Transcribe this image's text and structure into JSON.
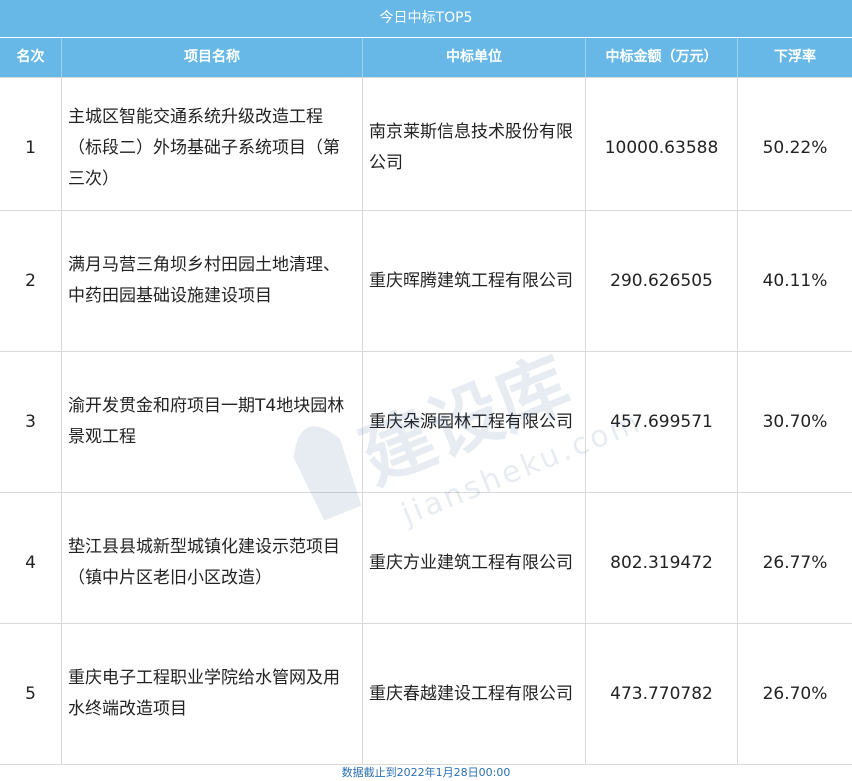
{
  "title": "今日中标TOP5",
  "headers": [
    "名次",
    "项目名称",
    "中标单位",
    "中标金额（万元）",
    "下浮率"
  ],
  "rows": [
    {
      "rank": "1",
      "project": "主城区智能交通系统升级改造工程（标段二）外场基础子系统项目（第三次）",
      "company": "南京莱斯信息技术股份有限公司",
      "amount": "10000.63588",
      "rate": "50.22%"
    },
    {
      "rank": "2",
      "project": "满月马营三角坝乡村田园土地清理、中药田园基础设施建设项目",
      "company": "重庆晖腾建筑工程有限公司",
      "amount": "290.626505",
      "rate": "40.11%"
    },
    {
      "rank": "3",
      "project": "渝开发贯金和府项目一期T4地块园林景观工程",
      "company": "重庆朵源园林工程有限公司",
      "amount": "457.699571",
      "rate": "30.70%"
    },
    {
      "rank": "4",
      "project": "垫江县县城新型城镇化建设示范项目（镇中片区老旧小区改造）",
      "company": "重庆方业建筑工程有限公司",
      "amount": "802.319472",
      "rate": "26.77%"
    },
    {
      "rank": "5",
      "project": "重庆电子工程职业学院给水管网及用水终端改造项目",
      "company": "重庆春越建设工程有限公司",
      "amount": "473.770782",
      "rate": "26.70%"
    }
  ],
  "watermark": {
    "brand": "建设库",
    "domain": "jiansheku.com"
  },
  "footer": "数据截止到2022年1月28日00:00",
  "colors": {
    "header_bg": "#67b8e6",
    "header_text": "#ffffff",
    "grid": "#d9d9d9",
    "footer_text": "#2a6fb0"
  }
}
